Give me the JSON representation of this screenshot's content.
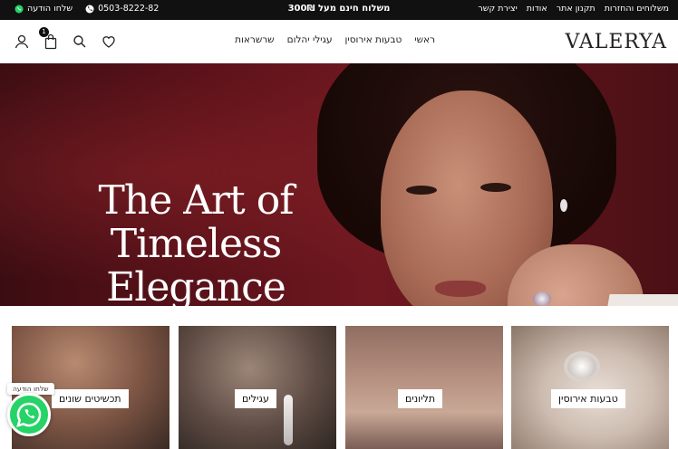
{
  "topbar": {
    "whatsapp_label": "שלחו הודעה",
    "phone": "0503-8222-82",
    "promo": "משלוח חינם מעל 300₪",
    "links": [
      "משלוחים והחזרות",
      "תקנון אתר",
      "אודות",
      "יצירת קשר"
    ]
  },
  "header": {
    "logo": "VALERYA",
    "nav": [
      "ראשי",
      "טבעות אירוסין",
      "עגילי יהלום",
      "שרשראות"
    ],
    "cart_count": "1"
  },
  "hero": {
    "title": "The Art of Timeless Elegance"
  },
  "categories": [
    {
      "label": "טבעות אירוסין"
    },
    {
      "label": "תליונים"
    },
    {
      "label": "עגילים"
    },
    {
      "label": "תכשיטים שונים"
    }
  ],
  "whatsapp": {
    "bubble": "שלחו הודעה"
  },
  "colors": {
    "topbar": "#111111",
    "hero_red": "#6f1820",
    "whatsapp": "#25d366"
  }
}
